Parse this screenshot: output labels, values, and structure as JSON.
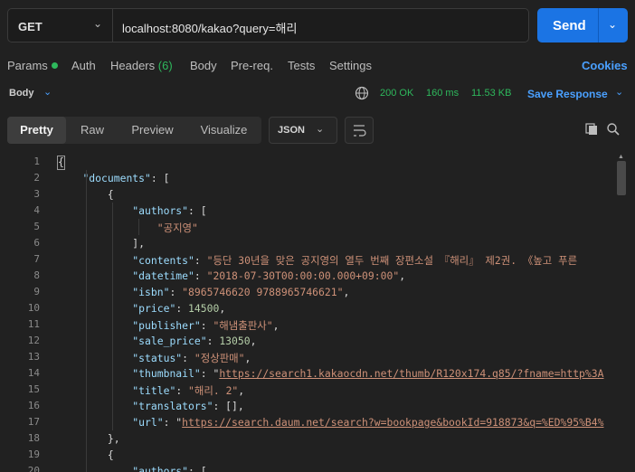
{
  "request": {
    "method": "GET",
    "url": "localhost:8080/kakao?query=해리",
    "send_label": "Send"
  },
  "tabs": {
    "params": "Params",
    "auth": "Auth",
    "headers": "Headers",
    "headers_count": "(6)",
    "body": "Body",
    "prereq": "Pre-req.",
    "tests": "Tests",
    "settings": "Settings",
    "cookies": "Cookies"
  },
  "response": {
    "body_label": "Body",
    "status": "200 OK",
    "time": "160 ms",
    "size": "11.53 KB",
    "save": "Save Response"
  },
  "view": {
    "tabs": [
      "Pretty",
      "Raw",
      "Preview",
      "Visualize"
    ],
    "active": "Pretty",
    "format": "JSON"
  },
  "code": {
    "line_numbers": [
      "1",
      "2",
      "3",
      "4",
      "5",
      "6",
      "7",
      "8",
      "9",
      "10",
      "11",
      "12",
      "13",
      "14",
      "15",
      "16",
      "17",
      "18",
      "19",
      "20"
    ],
    "lines": [
      [
        [
          "p",
          "{"
        ]
      ],
      [
        [
          "p",
          "    "
        ],
        [
          "k",
          "\"documents\""
        ],
        [
          "p",
          ": ["
        ]
      ],
      [
        [
          "p",
          "        {"
        ]
      ],
      [
        [
          "p",
          "            "
        ],
        [
          "k",
          "\"authors\""
        ],
        [
          "p",
          ": ["
        ]
      ],
      [
        [
          "p",
          "                "
        ],
        [
          "s",
          "\"공지영\""
        ]
      ],
      [
        [
          "p",
          "            ],"
        ]
      ],
      [
        [
          "p",
          "            "
        ],
        [
          "k",
          "\"contents\""
        ],
        [
          "p",
          ": "
        ],
        [
          "s",
          "\"등단 30년을 맞은 공지영의 열두 번째 장편소설 『해리』 제2권. 《높고 푸른"
        ]
      ],
      [
        [
          "p",
          "            "
        ],
        [
          "k",
          "\"datetime\""
        ],
        [
          "p",
          ": "
        ],
        [
          "s",
          "\"2018-07-30T00:00:00.000+09:00\""
        ],
        [
          "p",
          ","
        ]
      ],
      [
        [
          "p",
          "            "
        ],
        [
          "k",
          "\"isbn\""
        ],
        [
          "p",
          ": "
        ],
        [
          "s",
          "\"8965746620 9788965746621\""
        ],
        [
          "p",
          ","
        ]
      ],
      [
        [
          "p",
          "            "
        ],
        [
          "k",
          "\"price\""
        ],
        [
          "p",
          ": "
        ],
        [
          "n",
          "14500"
        ],
        [
          "p",
          ","
        ]
      ],
      [
        [
          "p",
          "            "
        ],
        [
          "k",
          "\"publisher\""
        ],
        [
          "p",
          ": "
        ],
        [
          "s",
          "\"해냄출판사\""
        ],
        [
          "p",
          ","
        ]
      ],
      [
        [
          "p",
          "            "
        ],
        [
          "k",
          "\"sale_price\""
        ],
        [
          "p",
          ": "
        ],
        [
          "n",
          "13050"
        ],
        [
          "p",
          ","
        ]
      ],
      [
        [
          "p",
          "            "
        ],
        [
          "k",
          "\"status\""
        ],
        [
          "p",
          ": "
        ],
        [
          "s",
          "\"정상판매\""
        ],
        [
          "p",
          ","
        ]
      ],
      [
        [
          "p",
          "            "
        ],
        [
          "k",
          "\"thumbnail\""
        ],
        [
          "p",
          ": \""
        ],
        [
          "u",
          "https://search1.kakaocdn.net/thumb/R120x174.q85/?fname=http%3A"
        ]
      ],
      [
        [
          "p",
          "            "
        ],
        [
          "k",
          "\"title\""
        ],
        [
          "p",
          ": "
        ],
        [
          "s",
          "\"해리. 2\""
        ],
        [
          "p",
          ","
        ]
      ],
      [
        [
          "p",
          "            "
        ],
        [
          "k",
          "\"translators\""
        ],
        [
          "p",
          ": [],"
        ]
      ],
      [
        [
          "p",
          "            "
        ],
        [
          "k",
          "\"url\""
        ],
        [
          "p",
          ": \""
        ],
        [
          "u",
          "https://search.daum.net/search?w=bookpage&bookId=918873&q=%ED%95%B4%"
        ]
      ],
      [
        [
          "p",
          "        },"
        ]
      ],
      [
        [
          "p",
          "        {"
        ]
      ],
      [
        [
          "p",
          "            "
        ],
        [
          "k",
          "\"authors\""
        ],
        [
          "p",
          ": ["
        ]
      ]
    ]
  }
}
